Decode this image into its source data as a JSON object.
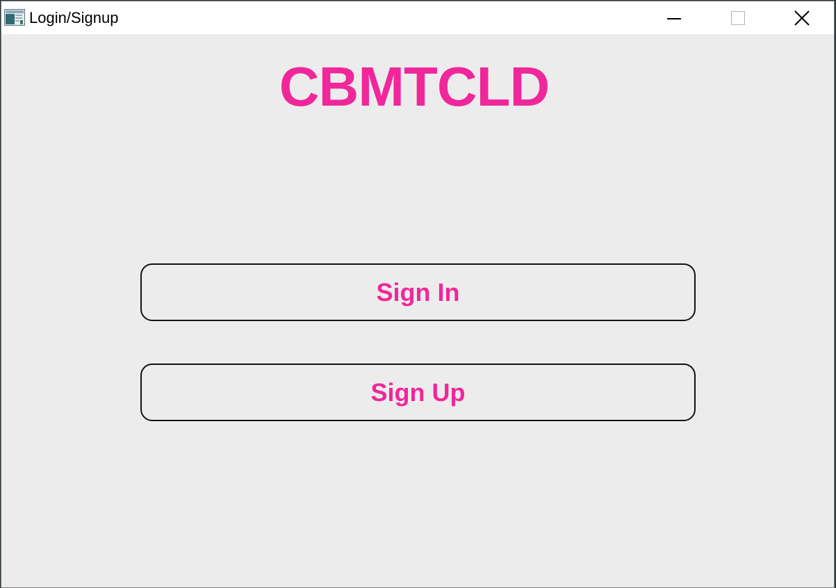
{
  "window": {
    "title": "Login/Signup",
    "icon": "application-window-icon"
  },
  "controls": {
    "minimize_icon": "minimize-icon",
    "maximize_icon": "maximize-icon",
    "close_icon": "close-icon"
  },
  "main": {
    "heading": "CBMTCLD",
    "signin_label": "Sign In",
    "signup_label": "Sign Up"
  },
  "colors": {
    "accent": "#f0279b",
    "background": "#ececec",
    "titlebar": "#ffffff",
    "button_border": "#111111"
  }
}
